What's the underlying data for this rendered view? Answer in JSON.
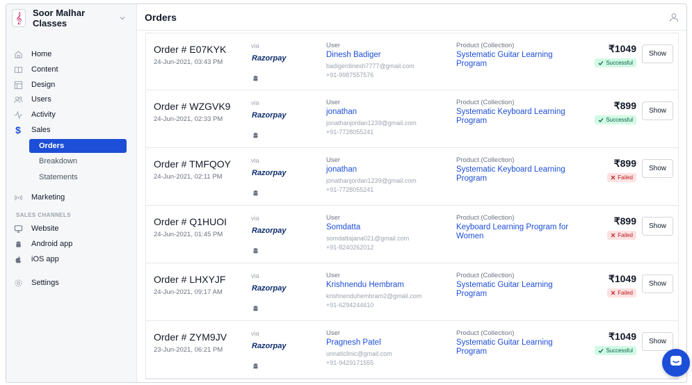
{
  "brand": {
    "name": "Soor Malhar Classes",
    "logo_glyph": "&",
    "logo_color": "#c2185b"
  },
  "sidebar": {
    "items": [
      {
        "label": "Home",
        "icon": "home-icon"
      },
      {
        "label": "Content",
        "icon": "book-icon"
      },
      {
        "label": "Design",
        "icon": "layout-icon"
      },
      {
        "label": "Users",
        "icon": "users-icon"
      },
      {
        "label": "Activity",
        "icon": "activity-icon"
      },
      {
        "label": "Sales",
        "icon": "dollar-icon"
      }
    ],
    "sales_sub": [
      {
        "label": "Orders",
        "active": true
      },
      {
        "label": "Breakdown",
        "active": false
      },
      {
        "label": "Statements",
        "active": false
      }
    ],
    "marketing": {
      "label": "Marketing",
      "icon": "broadcast-icon"
    },
    "section_label": "SALES CHANNELS",
    "channels": [
      {
        "label": "Website",
        "icon": "monitor-icon"
      },
      {
        "label": "Android app",
        "icon": "android-icon"
      },
      {
        "label": "iOS app",
        "icon": "apple-icon"
      }
    ],
    "settings": {
      "label": "Settings",
      "icon": "gear-icon"
    }
  },
  "header": {
    "title": "Orders",
    "user_icon": "user-icon"
  },
  "labels": {
    "via": "via",
    "gateway": "Razorpay",
    "user": "User",
    "product": "Product (Collection)",
    "show": "Show"
  },
  "orders": [
    {
      "order_no": "Order # E07KYK",
      "date": "24-Jun-2021, 03:43 PM",
      "user_name": "Dinesh Badiger",
      "email": "badigerdinesh7777@gmail.com",
      "phone": "+91-9987557576",
      "product": "Systematic Guitar Learning Program",
      "amount": "₹1049",
      "status": "Successful",
      "status_type": "success"
    },
    {
      "order_no": "Order # WZGVK9",
      "date": "24-Jun-2021, 02:33 PM",
      "user_name": "jonathan",
      "email": "jonathanjordan1239@gmail.com",
      "phone": "+91-7728055241",
      "product": "Systematic Keyboard Learning Program",
      "amount": "₹899",
      "status": "Successful",
      "status_type": "success"
    },
    {
      "order_no": "Order # TMFQOY",
      "date": "24-Jun-2021, 02:11 PM",
      "user_name": "jonathan",
      "email": "jonathanjordan1239@gmail.com",
      "phone": "+91-7728055241",
      "product": "Systematic Keyboard Learning Program",
      "amount": "₹899",
      "status": "Failed",
      "status_type": "failed"
    },
    {
      "order_no": "Order # Q1HUOI",
      "date": "24-Jun-2021, 01:45 PM",
      "user_name": "Somdatta",
      "email": "somdattajana021@gmail.com",
      "phone": "+91-8240262012",
      "product": "Keyboard Learning Program for Women",
      "amount": "₹899",
      "status": "Failed",
      "status_type": "failed"
    },
    {
      "order_no": "Order # LHXYJF",
      "date": "24-Jun-2021, 09:17 AM",
      "user_name": "Krishnendu Hembram",
      "email": "krishnenduhembram2@gmail.com",
      "phone": "+91-6294244610",
      "product": "Systematic Guitar Learning Program",
      "amount": "₹1049",
      "status": "Failed",
      "status_type": "failed"
    },
    {
      "order_no": "Order # ZYM9JV",
      "date": "23-Jun-2021, 06:21 PM",
      "user_name": "Pragnesh Patel",
      "email": "unnaticlinic@gmail.com",
      "phone": "+91-9429171555",
      "product": "Systematic Guitar Learning Program",
      "amount": "₹1049",
      "status": "Successful",
      "status_type": "success"
    }
  ],
  "colors": {
    "accent": "#1d4ed8",
    "success_bg": "#d1fae5",
    "failed_bg": "#fee2e2"
  },
  "chat": {
    "icon": "chat-icon"
  }
}
